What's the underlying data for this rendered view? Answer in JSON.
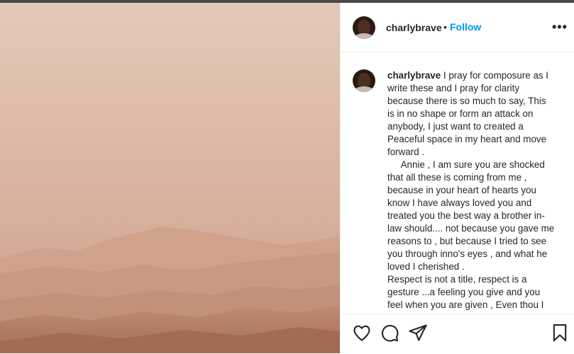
{
  "post": {
    "username": "charlybrave",
    "separator": "•",
    "follow_label": "Follow",
    "more_icon_label": "•••",
    "caption": "I pray for composure as I write these and I pray for clarity because there is so much to say, This is in no shape or form an attack on anybody, I just want to created a Peaceful space in my heart and move forward .\n     Annie , I am sure you are shocked that all these is coming from me , because in your heart of hearts you know I have always loved you and treated you the best way a brother in-law should.... not because you gave me reasons to , but because I tried to see you through inno's eyes , and what he loved I cherished .\nRespect is not a title, respect is a gesture ...a feeling you give and you feel when you are given , Even thou I have been nothing but respectful to"
  },
  "actions": {
    "icons": [
      "heart-icon",
      "comment-icon",
      "share-icon",
      "bookmark-icon"
    ]
  },
  "colors": {
    "accent": "#0095f6",
    "text": "#262626",
    "sky": "#e2c2b2",
    "dune": "#b9856a"
  }
}
